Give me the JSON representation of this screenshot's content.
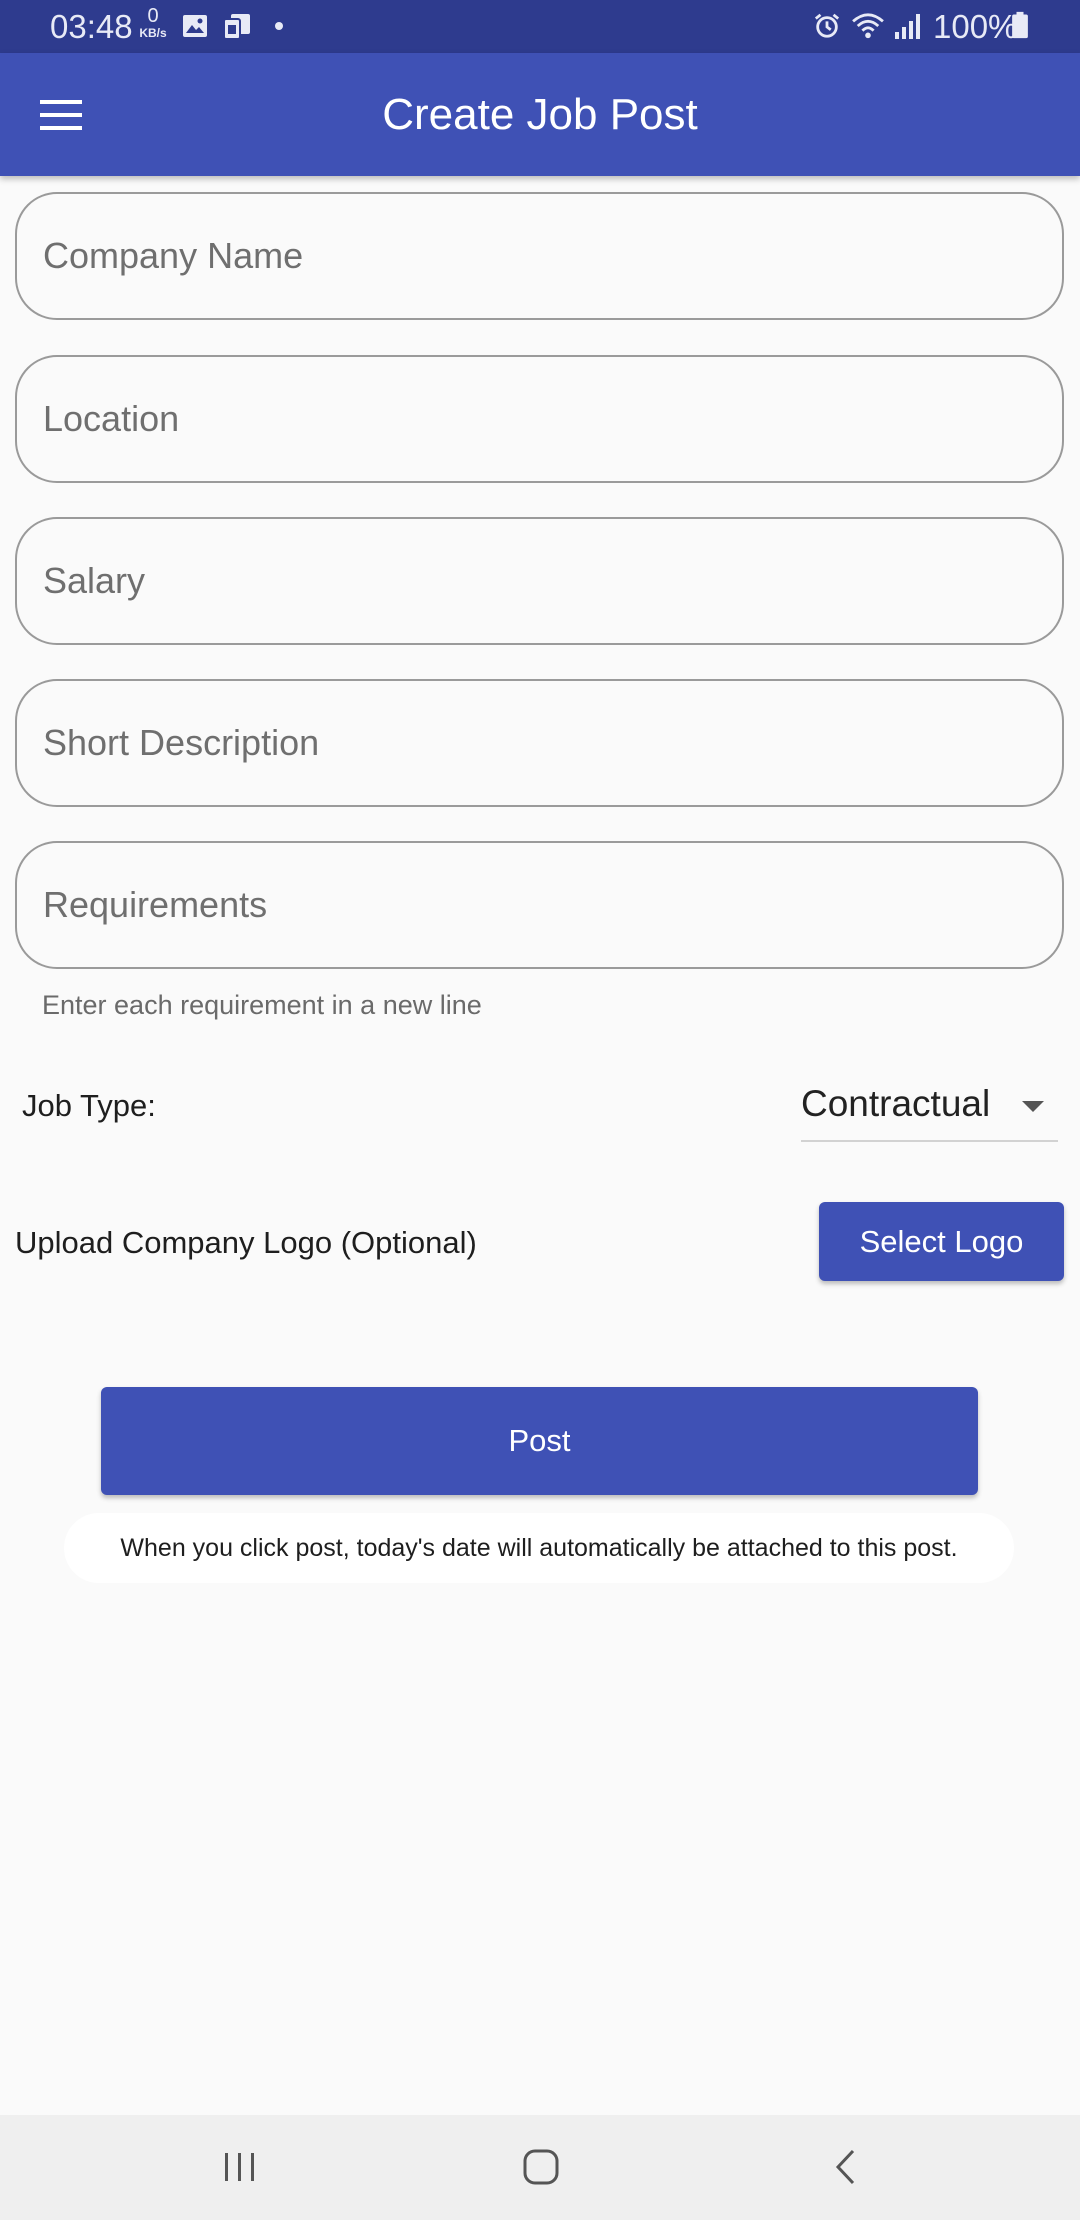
{
  "status_bar": {
    "time": "03:48",
    "network_speed_value": "0",
    "network_speed_unit": "KB/s",
    "battery": "100%",
    "icons": [
      "image-icon",
      "sim-icon",
      "alarm-icon",
      "wifi-icon",
      "signal-icon",
      "battery-icon"
    ]
  },
  "app_bar": {
    "title": "Create Job Post",
    "menu_icon": "hamburger-menu-icon"
  },
  "form": {
    "fields": [
      {
        "placeholder": "Company Name",
        "value": ""
      },
      {
        "placeholder": "Location",
        "value": ""
      },
      {
        "placeholder": "Salary",
        "value": ""
      },
      {
        "placeholder": "Short Description",
        "value": ""
      },
      {
        "placeholder": "Requirements",
        "value": ""
      }
    ],
    "requirements_helper": "Enter each requirement in a new line",
    "job_type_label": "Job Type:",
    "job_type_selected": "Contractual",
    "upload_label": "Upload Company Logo (Optional)",
    "select_logo_label": "Select Logo",
    "post_label": "Post",
    "note": "When you click post, today's date will automatically be attached to this post."
  },
  "nav_bar": {
    "buttons": [
      "recent-apps-icon",
      "home-icon",
      "back-icon"
    ]
  },
  "colors": {
    "status_bar": "#2e3b8e",
    "primary": "#3f51b5",
    "background": "#fafafa"
  }
}
